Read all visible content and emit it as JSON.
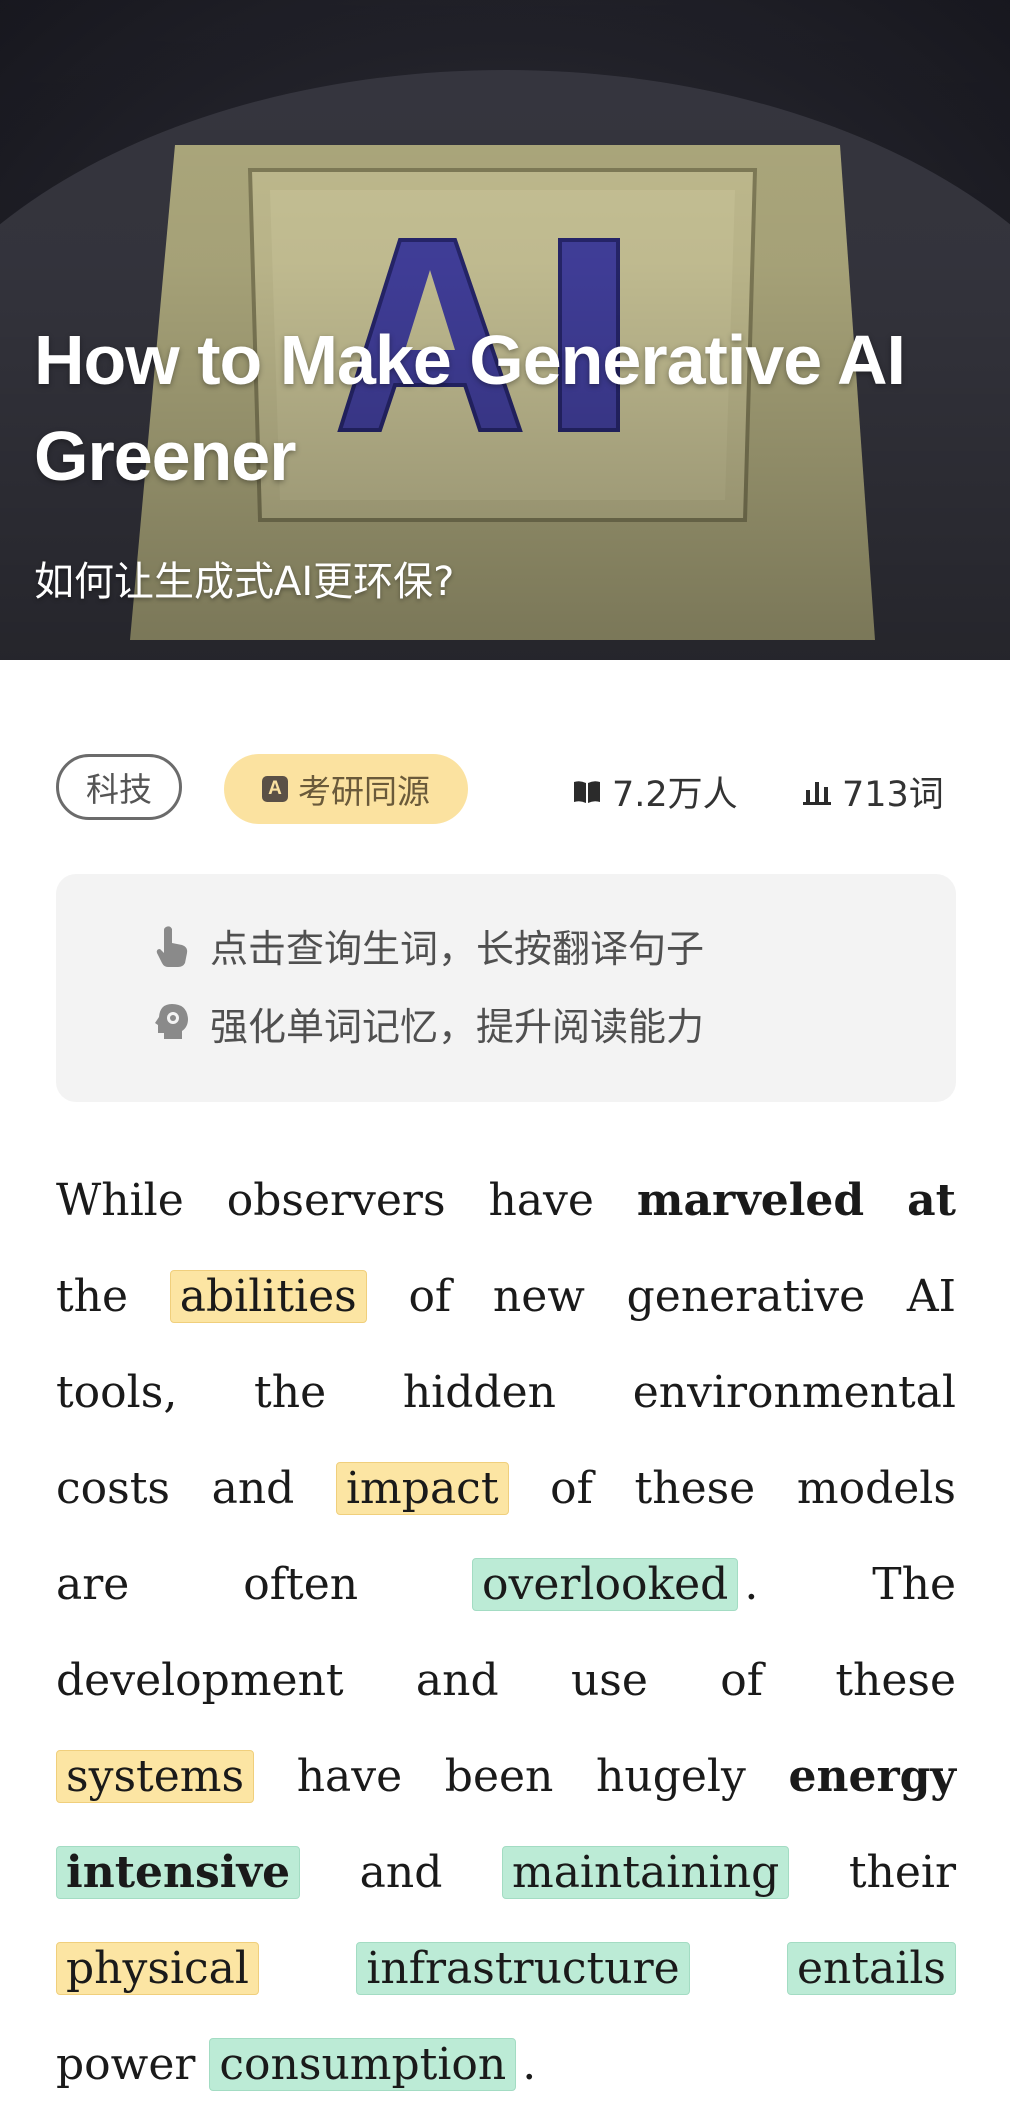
{
  "hero": {
    "art_text": "AI",
    "title": "How to Make Generative AI Greener",
    "subtitle": "如何让生成式AI更环保?"
  },
  "meta": {
    "category_tag": "科技",
    "source_tag": "考研同源",
    "source_badge": "A",
    "readers": "7.2万人",
    "word_count": "713词"
  },
  "tips": {
    "line1": "点击查询生词，长按翻译句子",
    "line2": "强化单词记忆，提升阅读能力"
  },
  "article": {
    "lines": [
      [
        {
          "t": "While"
        },
        {
          "t": "observers"
        },
        {
          "t": "have"
        },
        {
          "t": "marveled",
          "s": "b"
        },
        {
          "t": "at",
          "s": "b"
        }
      ],
      [
        {
          "t": "the"
        },
        {
          "t": "abilities",
          "s": "y"
        },
        {
          "t": "of"
        },
        {
          "t": "new"
        },
        {
          "t": "generative"
        },
        {
          "t": "AI"
        }
      ],
      [
        {
          "t": "tools,"
        },
        {
          "t": "the"
        },
        {
          "t": "hidden"
        },
        {
          "t": "environmental"
        }
      ],
      [
        {
          "t": "costs"
        },
        {
          "t": "and"
        },
        {
          "t": "impact",
          "s": "y"
        },
        {
          "t": "of"
        },
        {
          "t": "these"
        },
        {
          "t": "models"
        }
      ],
      [
        {
          "t": "are"
        },
        {
          "t": "often"
        },
        {
          "t": "overlooked",
          "s": "g",
          "after": "."
        },
        {
          "t": "The"
        }
      ],
      [
        {
          "t": "development"
        },
        {
          "t": "and"
        },
        {
          "t": "use"
        },
        {
          "t": "of"
        },
        {
          "t": "these"
        }
      ],
      [
        {
          "t": "systems",
          "s": "y"
        },
        {
          "t": "have"
        },
        {
          "t": "been"
        },
        {
          "t": "hugely"
        },
        {
          "t": "energy",
          "s": "b"
        }
      ],
      [
        {
          "t": "intensive",
          "s": "gb"
        },
        {
          "t": "and"
        },
        {
          "t": "maintaining",
          "s": "g"
        },
        {
          "t": "their"
        }
      ],
      [
        {
          "t": "physical",
          "s": "y"
        },
        {
          "t": "infrastructure",
          "s": "g"
        },
        {
          "t": "entails",
          "s": "g"
        }
      ],
      [
        {
          "t": "power"
        },
        {
          "t": "consumption",
          "s": "g",
          "after": "."
        }
      ]
    ],
    "last_line_index": 9
  },
  "colors": {
    "highlight_yellow": "#fce5a3",
    "highlight_green": "#bcebd6",
    "tag_yellow": "#fbe2a0",
    "tips_bg": "#f3f3f3"
  },
  "icons": {
    "readers": "book-icon",
    "words": "bar-chart-icon",
    "tip1": "pointing-hand-icon",
    "tip2": "brain-bulb-icon"
  }
}
